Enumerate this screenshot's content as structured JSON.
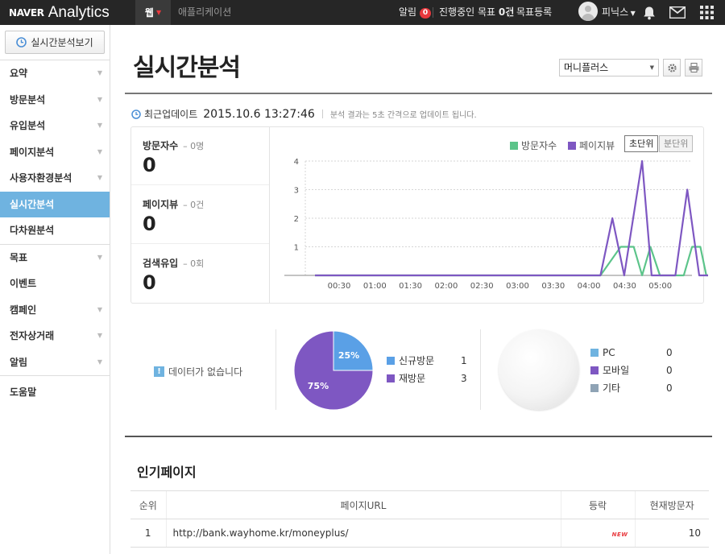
{
  "topbar": {
    "logo_naver": "NAVER",
    "logo_analytics": "Analytics",
    "nav_web": "웹",
    "nav_app": "애플리케이션",
    "alert_label": "알림",
    "alert_count": "0",
    "goal_progress_prefix": "진행중인 목표",
    "goal_progress_count": "0건",
    "goal_register": "목표등록",
    "user_name": "피닉스",
    "icons": [
      "bell-icon",
      "mail-icon",
      "grid-menu-icon"
    ]
  },
  "sidebar": {
    "realtime_button": "실시간분석보기",
    "items": [
      {
        "label": "요약",
        "arrow": true
      },
      {
        "label": "방문분석",
        "arrow": true
      },
      {
        "label": "유입분석",
        "arrow": true
      },
      {
        "label": "페이지분석",
        "arrow": true
      },
      {
        "label": "사용자환경분석",
        "arrow": true
      },
      {
        "label": "실시간분석",
        "arrow": false,
        "active": true
      },
      {
        "label": "다차원분석",
        "arrow": false
      },
      {
        "label": "목표",
        "arrow": true
      },
      {
        "label": "이벤트",
        "arrow": false
      },
      {
        "label": "캠페인",
        "arrow": true
      },
      {
        "label": "전자상거래",
        "arrow": true
      },
      {
        "label": "알림",
        "arrow": true
      },
      {
        "label": "도움말",
        "arrow": false
      }
    ]
  },
  "main": {
    "title": "실시간분석",
    "site_select": "머니플러스",
    "update_label": "최근업데이트",
    "update_time": "2015.10.6 13:27:46",
    "update_note": "분석 결과는 5초 간격으로 업데이트 됩니다.",
    "stats": [
      {
        "label": "방문자수",
        "sub": "– 0명",
        "value": "0"
      },
      {
        "label": "페이지뷰",
        "sub": "– 0건",
        "value": "0"
      },
      {
        "label": "검색유입",
        "sub": "– 0회",
        "value": "0"
      }
    ],
    "unit_seconds": "초단위",
    "unit_minutes": "분단위",
    "nodata": "데이터가 없습니다",
    "visit_legend": [
      {
        "label": "신규방문",
        "value": "1",
        "color": "#5aa0e6"
      },
      {
        "label": "재방문",
        "value": "3",
        "color": "#7e57c2"
      }
    ],
    "device_legend": [
      {
        "label": "PC",
        "value": "0",
        "color": "#6fb3e0"
      },
      {
        "label": "모바일",
        "value": "0",
        "color": "#7e57c2"
      },
      {
        "label": "기타",
        "value": "0",
        "color": "#8fa3b5"
      }
    ],
    "popular_title": "인기페이지",
    "table": {
      "headers": [
        "순위",
        "페이지URL",
        "등락",
        "현재방문자"
      ],
      "rows": [
        {
          "rank": "1",
          "url": "http://bank.wayhome.kr/moneyplus/",
          "change": "NEW",
          "visitors": "10"
        }
      ]
    }
  },
  "chart_data": [
    {
      "type": "line",
      "title": "",
      "legend": [
        "방문자수",
        "페이지뷰"
      ],
      "legend_position": "top-right",
      "grid": true,
      "ylim": [
        0,
        4
      ],
      "yticks": [
        1,
        2,
        3,
        4
      ],
      "xticks": [
        "00:30",
        "01:00",
        "01:30",
        "02:00",
        "02:30",
        "03:00",
        "03:30",
        "04:00",
        "04:30",
        "05:00"
      ],
      "series": [
        {
          "name": "방문자수",
          "color": "#5cc48a",
          "points": [
            [
              0,
              0
            ],
            [
              240,
              0
            ],
            [
              257,
              1
            ],
            [
              268,
              1
            ],
            [
              275,
              0
            ],
            [
              282,
              1
            ],
            [
              290,
              0
            ],
            [
              310,
              0
            ],
            [
              317,
              1
            ],
            [
              324,
              1
            ],
            [
              329,
              0
            ],
            [
              370,
              0
            ],
            [
              377,
              1
            ],
            [
              391,
              1
            ],
            [
              396,
              0
            ],
            [
              424,
              0
            ],
            [
              429,
              1
            ],
            [
              435,
              0
            ],
            [
              444,
              0
            ]
          ]
        },
        {
          "name": "페이지뷰",
          "color": "#7e57c2",
          "points": [
            [
              0,
              0
            ],
            [
              240,
              0
            ],
            [
              250,
              2
            ],
            [
              260,
              0
            ],
            [
              275,
              4
            ],
            [
              283,
              0
            ],
            [
              303,
              0
            ],
            [
              313,
              3
            ],
            [
              323,
              0
            ],
            [
              350,
              0
            ],
            [
              362,
              1
            ],
            [
              379,
              1
            ],
            [
              386,
              0
            ],
            [
              420,
              0
            ],
            [
              429,
              1
            ],
            [
              434,
              0
            ],
            [
              444,
              0
            ]
          ]
        }
      ]
    },
    {
      "type": "pie",
      "labels": [
        "신규방문",
        "재방문"
      ],
      "values": [
        1,
        3
      ],
      "percent_labels": [
        "25%",
        "75%"
      ],
      "colors": [
        "#5aa0e6",
        "#7e57c2"
      ]
    },
    {
      "type": "pie",
      "labels": [
        "PC",
        "모바일",
        "기타"
      ],
      "values": [
        0,
        0,
        0
      ],
      "colors": [
        "#6fb3e0",
        "#7e57c2",
        "#8fa3b5"
      ]
    }
  ]
}
